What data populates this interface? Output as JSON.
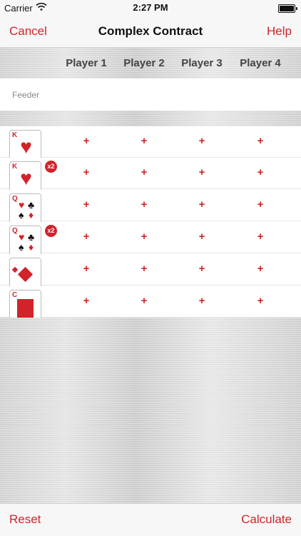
{
  "status_bar": {
    "carrier": "Carrier",
    "time": "2:27 PM"
  },
  "nav": {
    "cancel_label": "Cancel",
    "title": "Complex Contract",
    "help_label": "Help"
  },
  "players": [
    "Player 1",
    "Player 2",
    "Player 3",
    "Player 4"
  ],
  "feeder_label": "Feeder",
  "contracts": [
    {
      "name": "King of Hearts",
      "rank": "K",
      "badge": ""
    },
    {
      "name": "King of Hearts x2",
      "rank": "K",
      "badge": "x2"
    },
    {
      "name": "Queens",
      "rank": "Q",
      "badge": ""
    },
    {
      "name": "Queens x2",
      "rank": "Q",
      "badge": "x2"
    },
    {
      "name": "Diamonds",
      "rank": "",
      "badge": ""
    },
    {
      "name": "Collections",
      "rank": "C",
      "badge": ""
    }
  ],
  "plus_symbol": "+",
  "bottom": {
    "reset_label": "Reset",
    "calculate_label": "Calculate"
  },
  "colors": {
    "accent": "#d2232a"
  }
}
